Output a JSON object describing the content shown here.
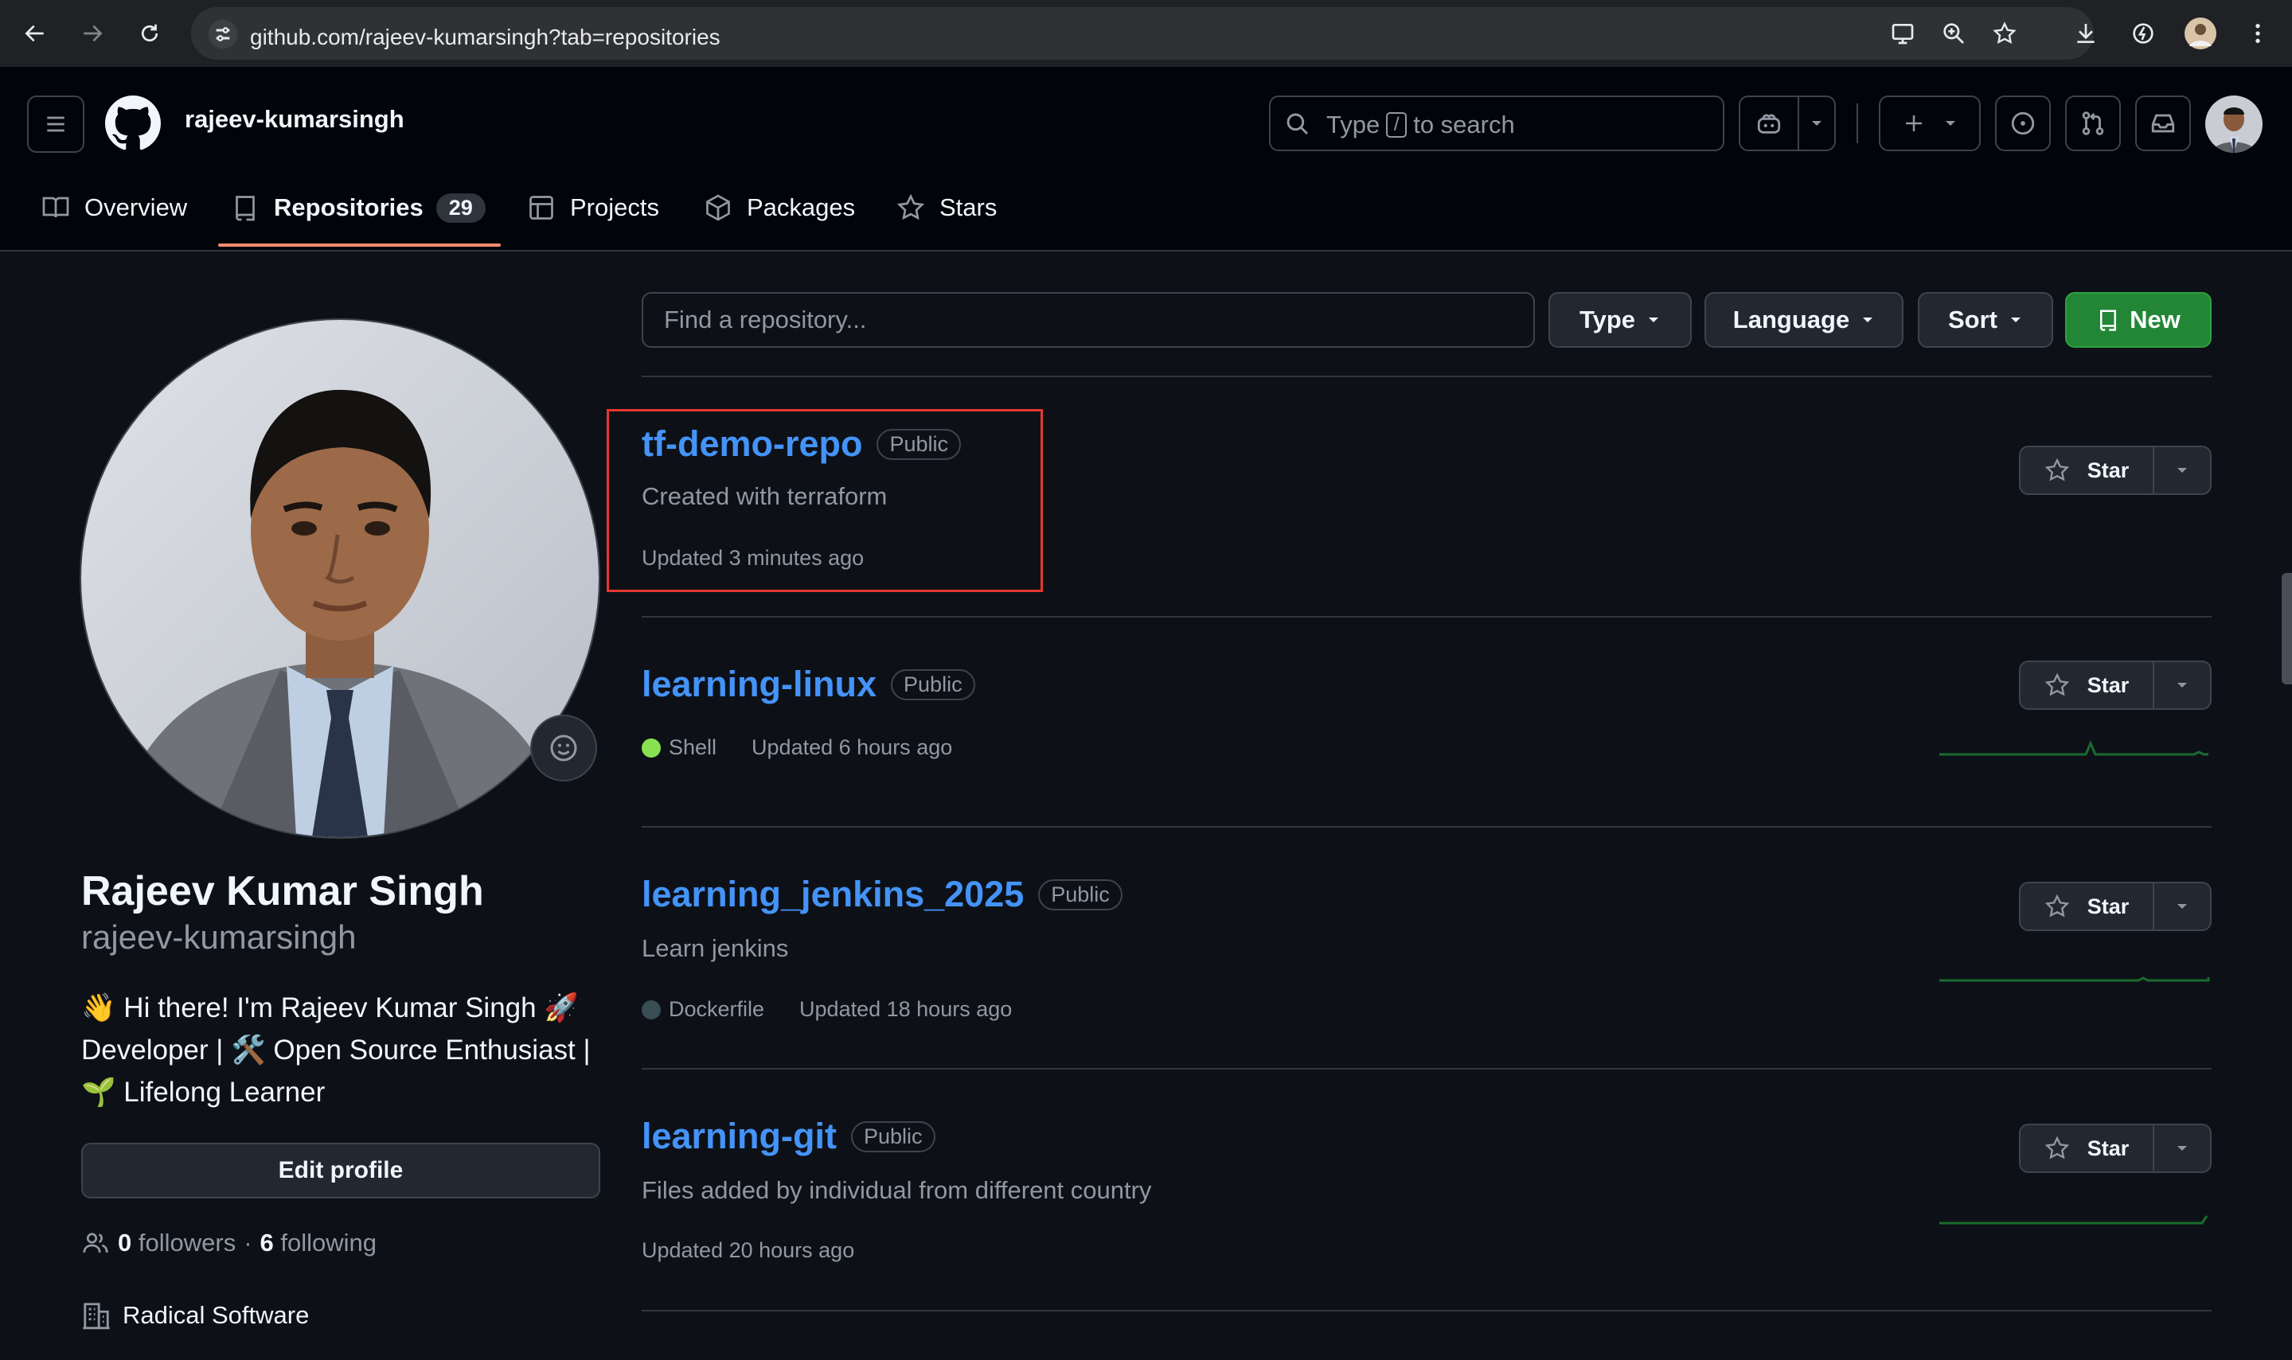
{
  "browser": {
    "url": "github.com/rajeev-kumarsingh?tab=repositories"
  },
  "header": {
    "username": "rajeev-kumarsingh",
    "search": {
      "before": "Type",
      "key": "/",
      "after": "to search"
    }
  },
  "nav": {
    "tabs": [
      {
        "label": "Overview",
        "icon": "book-icon"
      },
      {
        "label": "Repositories",
        "icon": "repo-icon",
        "count": "29",
        "active": true
      },
      {
        "label": "Projects",
        "icon": "table-icon"
      },
      {
        "label": "Packages",
        "icon": "package-icon"
      },
      {
        "label": "Stars",
        "icon": "star-icon"
      }
    ]
  },
  "profile": {
    "full_name": "Rajeev Kumar Singh",
    "login": "rajeev-kumarsingh",
    "bio": "👋 Hi there! I'm Rajeev Kumar Singh 🚀 Developer | 🛠️ Open Source Enthusiast | 🌱 Lifelong Learner",
    "edit_label": "Edit profile",
    "followers_count": "0",
    "followers_label": "followers",
    "separator": "·",
    "following_count": "6",
    "following_label": "following",
    "organization": "Radical Software"
  },
  "filters": {
    "search_placeholder": "Find a repository...",
    "type_label": "Type",
    "language_label": "Language",
    "sort_label": "Sort",
    "new_label": "New"
  },
  "repos": [
    {
      "name": "tf-demo-repo",
      "visibility": "Public",
      "description": "Created with terraform",
      "language": "",
      "updated": "Updated 3 minutes ago",
      "star_label": "Star"
    },
    {
      "name": "learning-linux",
      "visibility": "Public",
      "description": "",
      "language": "Shell",
      "language_color": "#89e051",
      "updated": "Updated 6 hours ago",
      "star_label": "Star"
    },
    {
      "name": "learning_jenkins_2025",
      "visibility": "Public",
      "description": "Learn jenkins",
      "language": "Dockerfile",
      "language_color": "#384d54",
      "updated": "Updated 18 hours ago",
      "star_label": "Star"
    },
    {
      "name": "learning-git",
      "visibility": "Public",
      "description": "Files added by individual from different country",
      "language": "",
      "updated": "Updated 20 hours ago",
      "star_label": "Star"
    }
  ],
  "colors": {
    "accent_link": "#4493f8",
    "primary_button": "#238636",
    "tab_underline": "#fd8c73",
    "highlight_box": "#e5382e"
  }
}
